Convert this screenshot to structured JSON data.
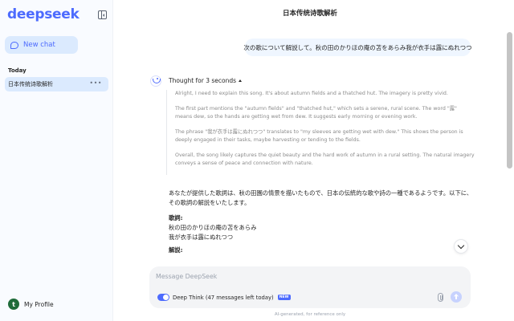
{
  "sidebar": {
    "logo": "deepseek",
    "new_chat_label": "New chat",
    "section_today": "Today",
    "history": [
      {
        "label": "日本传统诗歌解析"
      }
    ],
    "profile": {
      "avatar_letter": "t",
      "label": "My Profile"
    }
  },
  "main": {
    "title": "日本传统诗歌解析",
    "user_message": "次の歌について解説して。秋の田のかりほの庵の苫をあらみ我が衣手は露にぬれつつ",
    "thought_label": "Thought for 3 seconds",
    "thinking": [
      "Alright, I need to explain this song. It's about autumn fields and a thatched hut. The imagery is pretty vivid.",
      "The first part mentions the \"autumn fields\" and \"thatched hut,\" which sets a serene, rural scene. The word \"露\" means dew, so the hands are getting wet from dew. It suggests early morning or evening work.",
      "The phrase \"我が衣手は露にぬれつつ\" translates to \"my sleeves are getting wet with dew.\" This shows the person is deeply engaged in their tasks, maybe harvesting or tending to the fields.",
      "Overall, the song likely captures the quiet beauty and the hard work of autumn in a rural setting. The natural imagery conveys a sense of peace and connection with nature."
    ],
    "answer": {
      "intro": "あなたが提供した歌詞は、秋の田園の情景を描いたもので、日本の伝統的な歌や詩の一種であるようです。以下に、その歌詞の解説をいたします。",
      "lyrics_heading": "歌詞:",
      "lyrics_line1": "秋の田のかりほの庵の苫をあらみ",
      "lyrics_line2": "我が衣手は露にぬれつつ",
      "explanation_heading": "解説:"
    }
  },
  "composer": {
    "placeholder": "Message DeepSeek",
    "deep_think_label": "Deep Think (47 messages left today)",
    "new_badge": "NEW"
  },
  "footer_note": "AI-generated, for reference only",
  "colors": {
    "accent": "#4d6bfe",
    "sidebar_bg": "#f9fbff",
    "selected_bg": "#dbeafe"
  }
}
